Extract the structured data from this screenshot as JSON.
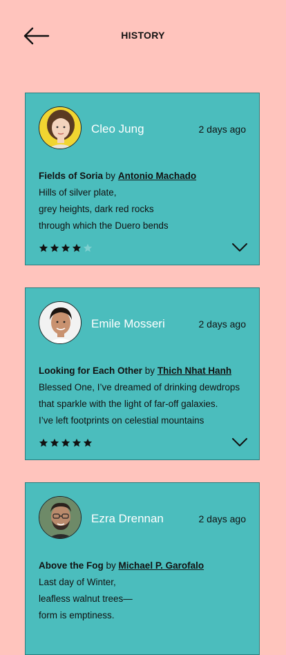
{
  "header": {
    "title": "HISTORY",
    "back_icon": "arrow-left-icon"
  },
  "colors": {
    "background": "#ffc4bd",
    "card": "#4bbdbd",
    "star_filled": "#111111",
    "star_empty": "#7fd0d0"
  },
  "cards": [
    {
      "user": "Cleo Jung",
      "time": "2 days ago",
      "poem_title": "Fields of Soria",
      "by": "by",
      "author": "Antonio Machado",
      "lines": [
        "Hills of silver plate,",
        "grey heights, dark red rocks",
        "through which the Duero bends"
      ],
      "rating": 4,
      "rating_max": 5
    },
    {
      "user": "Emile Mosseri",
      "time": "2 days ago",
      "poem_title": "Looking for Each Other",
      "by": "by",
      "author": "Thich Nhat Hanh",
      "lines": [
        "Blessed One, I’ve dreamed of drinking dewdrops",
        "that sparkle with the light of far-off galaxies.",
        "I’ve left footprints on celestial mountains"
      ],
      "rating": 5,
      "rating_max": 5
    },
    {
      "user": "Ezra Drennan",
      "time": "2 days ago",
      "poem_title": "Above the Fog",
      "by": "by",
      "author": "Michael P. Garofalo",
      "lines": [
        "Last day of Winter,",
        "leafless walnut trees—",
        "form is emptiness."
      ],
      "rating": null,
      "rating_max": 5
    }
  ]
}
